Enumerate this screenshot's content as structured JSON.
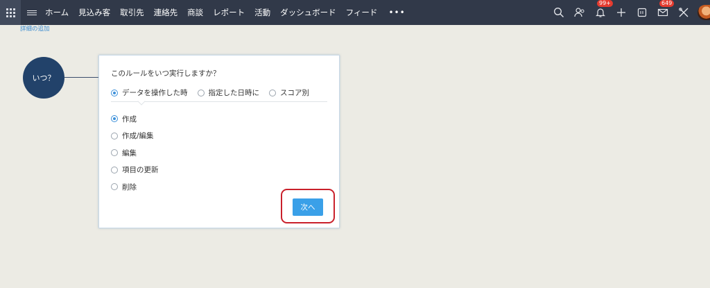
{
  "nav": {
    "items": [
      {
        "label": "ホーム"
      },
      {
        "label": "見込み客"
      },
      {
        "label": "取引先"
      },
      {
        "label": "連絡先"
      },
      {
        "label": "商談"
      },
      {
        "label": "レポート"
      },
      {
        "label": "活動"
      },
      {
        "label": "ダッシュボード"
      },
      {
        "label": "フィード"
      }
    ],
    "more": "•••",
    "notification_badge": "99+",
    "mail_badge": "649"
  },
  "detail_link": "詳細の追加",
  "when_circle": "いつ？",
  "rule_panel": {
    "title": "このルールをいつ実行しますか？",
    "trigger_options": [
      {
        "label": "データを操作した時",
        "checked": true
      },
      {
        "label": "指定した日時に",
        "checked": false
      },
      {
        "label": "スコア別",
        "checked": false
      }
    ],
    "action_options": [
      {
        "label": "作成",
        "checked": true
      },
      {
        "label": "作成/編集",
        "checked": false
      },
      {
        "label": "編集",
        "checked": false
      },
      {
        "label": "項目の更新",
        "checked": false
      },
      {
        "label": "削除",
        "checked": false
      }
    ],
    "next_button": "次へ"
  },
  "colors": {
    "nav_bg": "#313949",
    "accent": "#3aa0e8",
    "highlight": "#c9202b",
    "circle": "#22426a"
  }
}
